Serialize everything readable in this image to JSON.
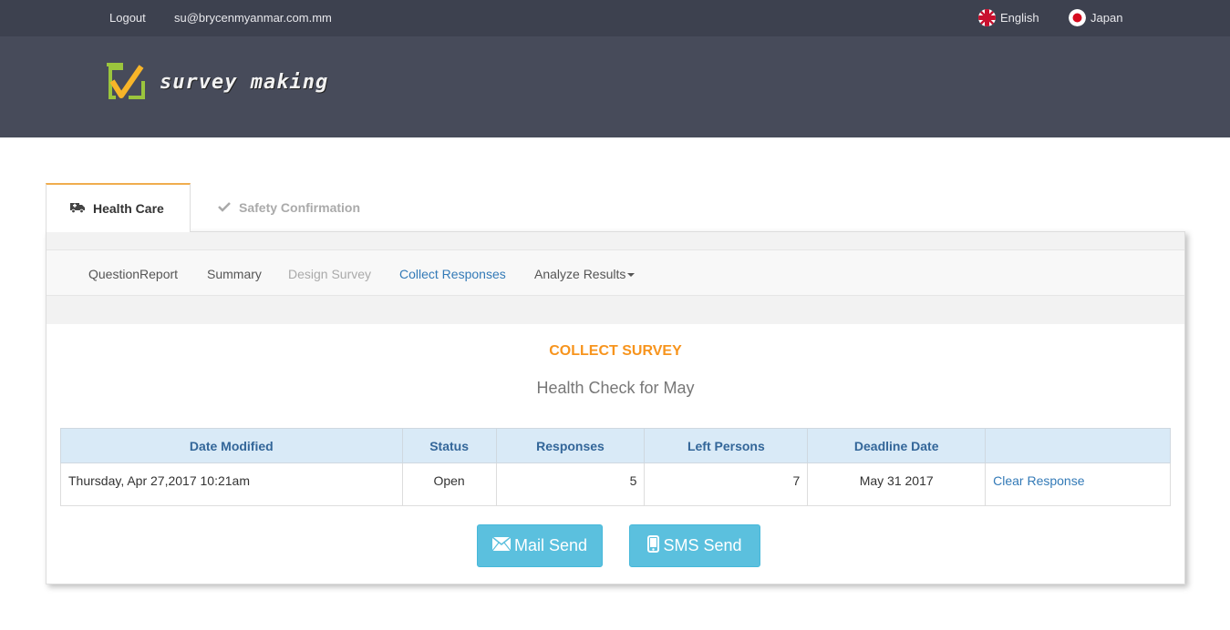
{
  "topbar": {
    "logout_label": "Logout",
    "user_email": "su@brycenmyanmar.com.mm",
    "lang_english": "English",
    "lang_japan": "Japan"
  },
  "header": {
    "logo_text": "survey making"
  },
  "tabs": [
    {
      "label": "Health Care",
      "icon": "ambulance-icon",
      "active": true
    },
    {
      "label": "Safety Confirmation",
      "icon": "check-icon",
      "active": false
    }
  ],
  "subnav": {
    "items": [
      {
        "label": "QuestionReport",
        "state": "normal"
      },
      {
        "label": "Summary",
        "state": "normal"
      },
      {
        "label": "Design Survey",
        "state": "disabled"
      },
      {
        "label": "Collect Responses",
        "state": "active"
      },
      {
        "label": "Analyze Results",
        "state": "dropdown"
      }
    ]
  },
  "main": {
    "title": "COLLECT SURVEY",
    "survey_name": "Health Check for May",
    "table": {
      "headers": [
        "Date Modified",
        "Status",
        "Responses",
        "Left Persons",
        "Deadline Date",
        ""
      ],
      "rows": [
        {
          "date_modified": "Thursday, Apr 27,2017 10:21am",
          "status": "Open",
          "responses": "5",
          "left_persons": "7",
          "deadline": "May 31 2017",
          "action": "Clear Response"
        }
      ]
    },
    "buttons": {
      "mail_send": "Mail Send",
      "sms_send": "SMS Send"
    }
  },
  "colors": {
    "topbar_bg": "#3d414f",
    "header_bg": "#474b5a",
    "accent_orange": "#f7941d",
    "link_blue": "#337ab7",
    "button_info": "#5bc0de",
    "table_header_bg": "#d9eaf7",
    "status_open": "#3c9b3c"
  }
}
